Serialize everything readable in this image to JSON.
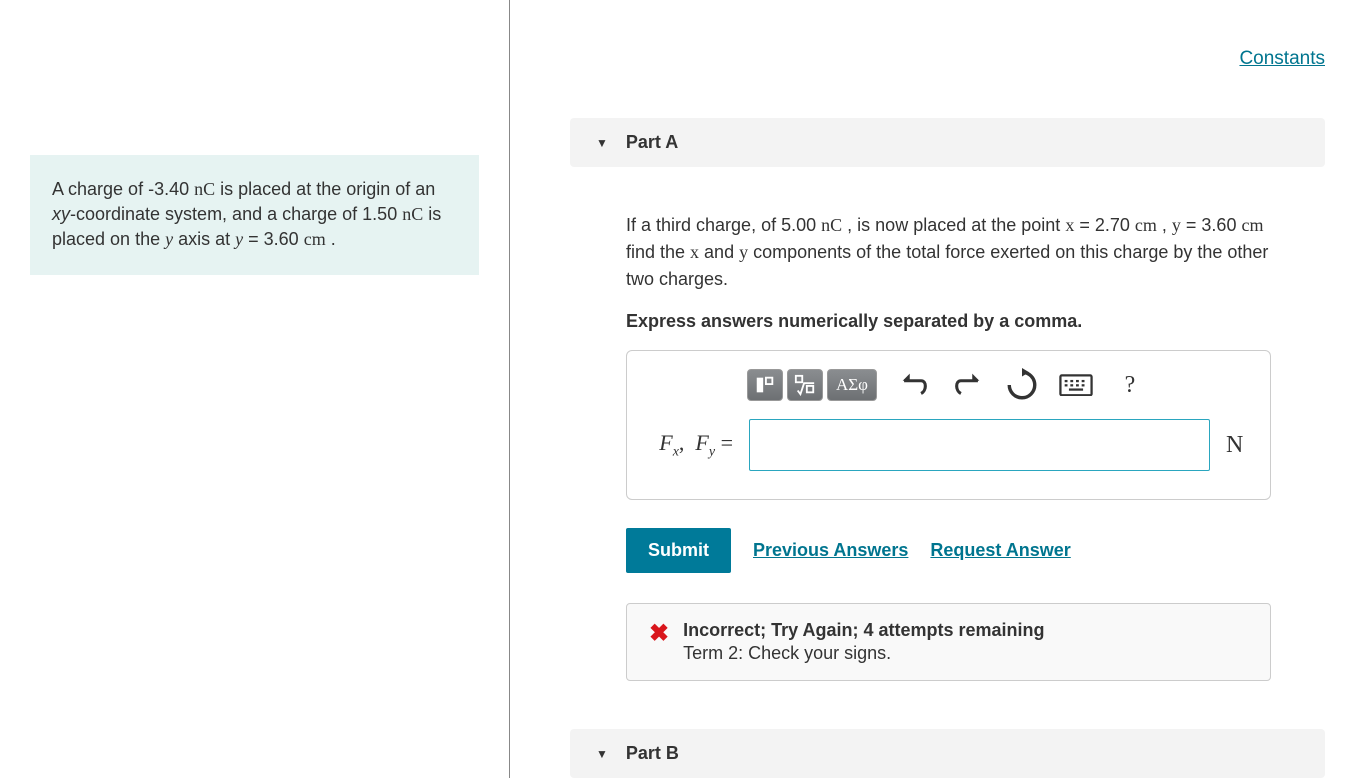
{
  "constants_link": "Constants",
  "problem": {
    "q1_val": "-3.40",
    "q1_unit": "nC",
    "q2_val": "1.50",
    "q2_unit": "nC",
    "y_val": "3.60",
    "y_unit": "cm"
  },
  "partA": {
    "label": "Part A",
    "q3_val": "5.00",
    "q3_unit": "nC",
    "x_val": "2.70",
    "x_unit": "cm",
    "y_val": "3.60",
    "y_unit_trail": "cm",
    "instruction": "Express answers numerically separated by a comma.",
    "answer_label_prefix": "F",
    "answer_label_sub1": "x",
    "answer_label_sub2": "y",
    "answer_unit": "N",
    "input_value": "",
    "greek_label": "ΑΣφ",
    "submit_label": "Submit",
    "prev_answers_label": "Previous Answers",
    "request_answer_label": "Request Answer",
    "feedback_line1": "Incorrect; Try Again; 4 attempts remaining",
    "feedback_line2": "Term 2: Check your signs."
  },
  "partB": {
    "label": "Part B"
  }
}
